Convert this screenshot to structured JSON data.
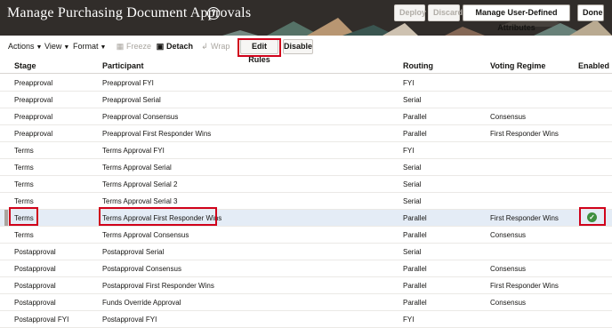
{
  "header": {
    "title": "Manage Purchasing Document Approvals",
    "help_icon": "?",
    "buttons": {
      "deploy": "Deploy",
      "discard": "Discard",
      "manage_attributes": "Manage User-Defined Attributes",
      "done": "Done"
    }
  },
  "toolbar": {
    "actions": "Actions",
    "view": "View",
    "format": "Format",
    "freeze": "Freeze",
    "detach": "Detach",
    "wrap": "Wrap",
    "edit_rules": "Edit Rules",
    "disable": "Disable"
  },
  "table": {
    "columns": [
      "Stage",
      "Participant",
      "Routing",
      "Voting Regime",
      "Enabled"
    ],
    "rows": [
      {
        "stage": "Preapproval",
        "participant": "Preapproval FYI",
        "routing": "FYI",
        "voting": ""
      },
      {
        "stage": "Preapproval",
        "participant": "Preapproval Serial",
        "routing": "Serial",
        "voting": ""
      },
      {
        "stage": "Preapproval",
        "participant": "Preapproval Consensus",
        "routing": "Parallel",
        "voting": "Consensus"
      },
      {
        "stage": "Preapproval",
        "participant": "Preapproval First Responder Wins",
        "routing": "Parallel",
        "voting": "First Responder Wins"
      },
      {
        "stage": "Terms",
        "participant": "Terms Approval FYI",
        "routing": "FYI",
        "voting": ""
      },
      {
        "stage": "Terms",
        "participant": "Terms Approval Serial",
        "routing": "Serial",
        "voting": ""
      },
      {
        "stage": "Terms",
        "participant": "Terms Approval Serial 2",
        "routing": "Serial",
        "voting": ""
      },
      {
        "stage": "Terms",
        "participant": "Terms Approval Serial 3",
        "routing": "Serial",
        "voting": ""
      },
      {
        "stage": "Terms",
        "participant": "Terms Approval First Responder Wins",
        "routing": "Parallel",
        "voting": "First Responder Wins"
      },
      {
        "stage": "Terms",
        "participant": "Terms Approval Consensus",
        "routing": "Parallel",
        "voting": "Consensus"
      },
      {
        "stage": "Postapproval",
        "participant": "Postapproval Serial",
        "routing": "Serial",
        "voting": ""
      },
      {
        "stage": "Postapproval",
        "participant": "Postapproval Consensus",
        "routing": "Parallel",
        "voting": "Consensus"
      },
      {
        "stage": "Postapproval",
        "participant": "Postapproval First Responder Wins",
        "routing": "Parallel",
        "voting": "First Responder Wins"
      },
      {
        "stage": "Postapproval",
        "participant": "Funds Override Approval",
        "routing": "Parallel",
        "voting": "Consensus"
      },
      {
        "stage": "Postapproval FYI",
        "participant": "Postapproval FYI",
        "routing": "FYI",
        "voting": ""
      }
    ],
    "selected_row_index": 8,
    "selected_row_enabled": true
  },
  "colors": {
    "header_bg": "#312d2a",
    "highlight_red": "#d0021b",
    "selected_row": "#e4ecf6",
    "enabled_green": "#3f8f3f"
  }
}
